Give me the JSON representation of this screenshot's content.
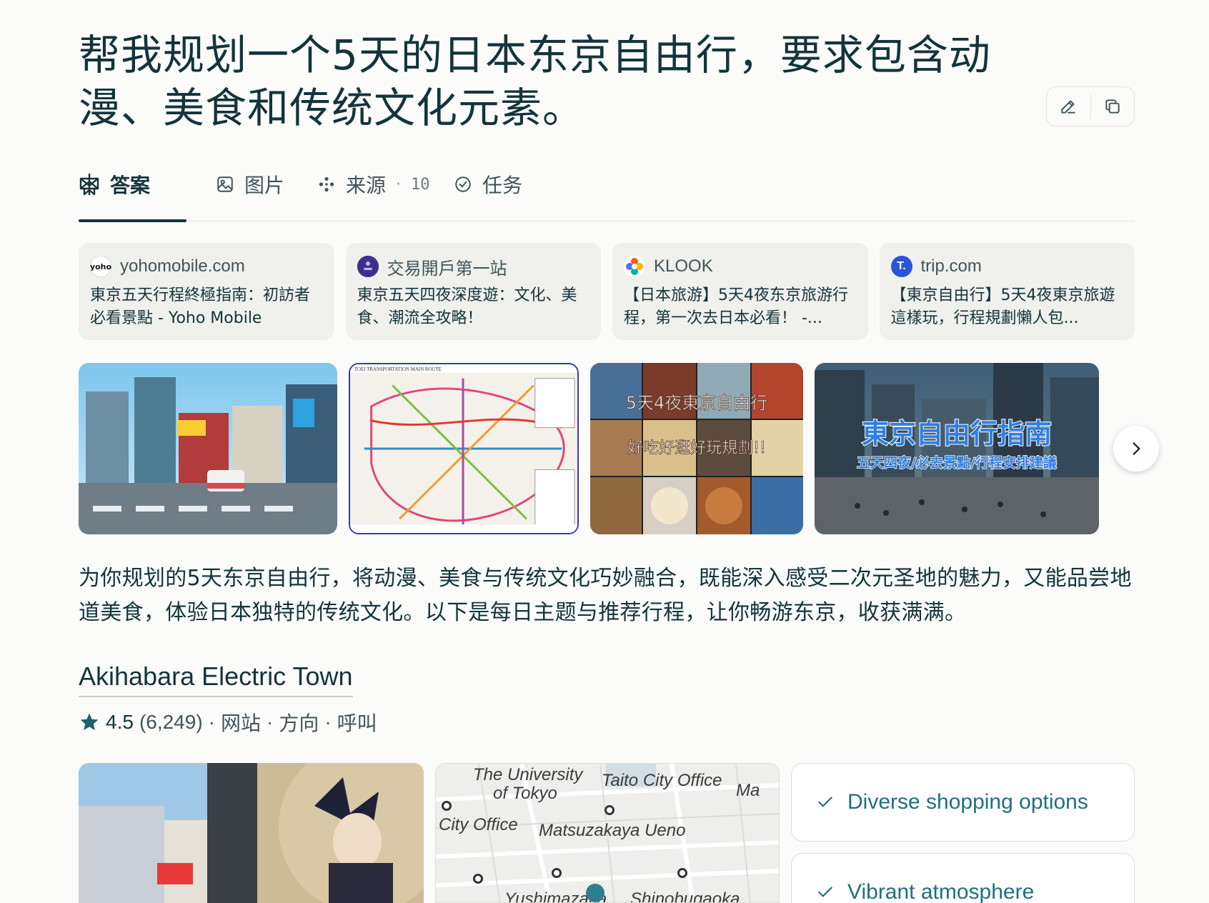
{
  "question": "帮我规划一个5天的日本东京自由行，要求包含动漫、美食和传统文化元素。",
  "title_actions": {
    "edit_icon": "edit-icon",
    "copy_icon": "copy-icon"
  },
  "tabs": [
    {
      "label": "答案",
      "icon": "perplexity-logo-icon"
    },
    {
      "label": "图片",
      "icon": "image-icon"
    },
    {
      "label": "来源",
      "icon": "sources-icon",
      "count": "10",
      "sep": "·"
    },
    {
      "label": "任务",
      "icon": "check-circle-icon"
    }
  ],
  "sources": [
    {
      "favicon_text": "yoho",
      "domain": "yohomobile.com",
      "title": "東京五天行程終極指南：初訪者必看景點 - Yoho Mobile",
      "color": "#ffffff"
    },
    {
      "favicon_text": "",
      "domain": "交易開戶第一站",
      "title": "東京五天四夜深度遊：文化、美食、潮流全攻略！",
      "color": "#3b2f8f"
    },
    {
      "favicon_text": "",
      "domain": "KLOOK",
      "title": "【日本旅游】5天4夜东京旅游行程，第一次去日本必看！ -...",
      "color": "#ff5b00"
    },
    {
      "favicon_text": "T.",
      "domain": "trip.com",
      "title": "【東京自由行】5天4夜東京旅遊這樣玩，行程規劃懶人包...",
      "color": "#2b55d8"
    }
  ],
  "images": [
    {
      "name": "shibuya-street-image",
      "caption_lines": []
    },
    {
      "name": "toei-map-image",
      "caption_lines": [
        "TOEI TRANSPORTATION MAIN ROUTE"
      ]
    },
    {
      "name": "tokyo-food-collage-image",
      "caption_lines": [
        "5天4夜東京自由行",
        "好吃好逛好玩規劃!!"
      ]
    },
    {
      "name": "tokyo-guide-image",
      "caption_lines": [
        "東京自由行指南",
        "五天四夜/必去景點/行程安排建議"
      ]
    }
  ],
  "summary": "为你规划的5天东京自由行，将动漫、美食与传统文化巧妙融合，既能深入感受二次元圣地的魅力，又能品尝地道美食，体验日本独特的传统文化。以下是每日主题与推荐行程，让你畅游东京，收获满满。",
  "place": {
    "name": "Akihabara Electric Town",
    "rating": "4.5",
    "reviews": "(6,249)",
    "links": [
      "网站",
      "方向",
      "呼叫"
    ],
    "sep": "·"
  },
  "map_labels": [
    "The University",
    "of Tokyo",
    "Taito City Office",
    "Ma",
    "City Office",
    "Matsuzakaya Ueno",
    "Yushimazaka",
    "Shinobugaoka"
  ],
  "features": [
    "Diverse shopping options",
    "Vibrant atmosphere"
  ],
  "colors": {
    "accent": "#13343b",
    "feature_text": "#1f6f7f",
    "card_bg": "#f0f0ec",
    "page_bg": "#fbfbf9"
  }
}
